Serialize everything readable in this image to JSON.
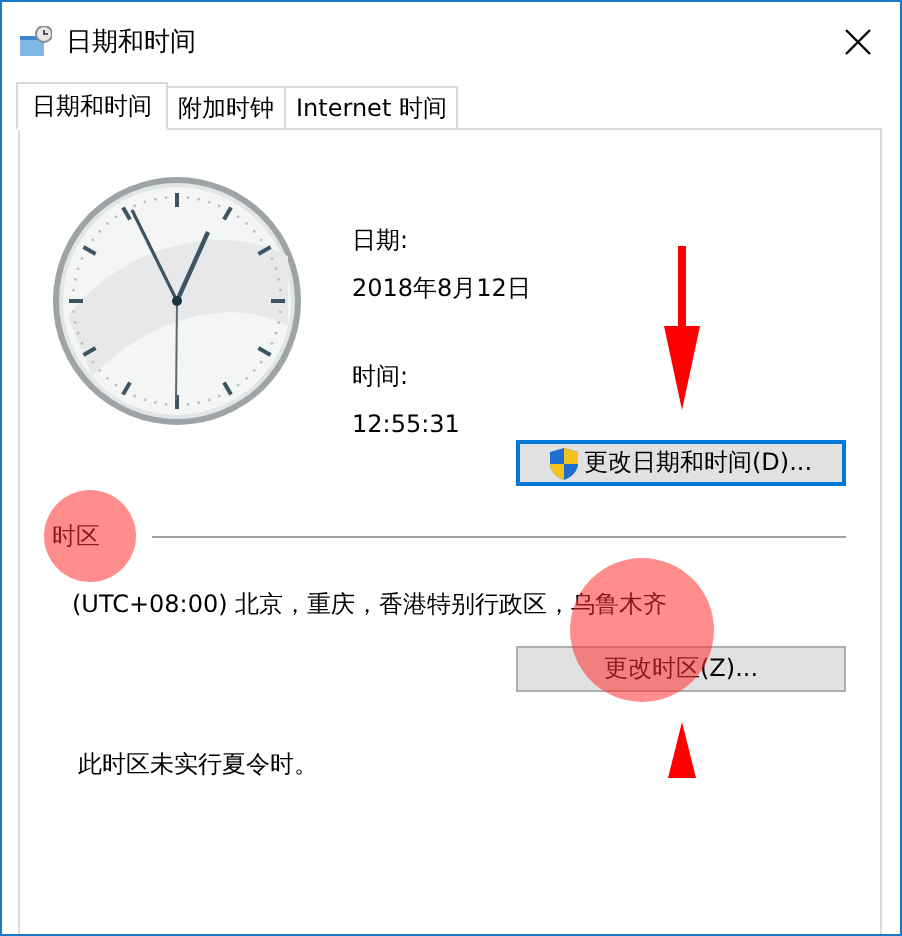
{
  "window": {
    "title": "日期和时间"
  },
  "tabs": [
    {
      "label": "日期和时间",
      "selected": true
    },
    {
      "label": "附加时钟",
      "selected": false
    },
    {
      "label": "Internet 时间",
      "selected": false
    }
  ],
  "date": {
    "label": "日期:",
    "value": "2018年8月12日"
  },
  "time": {
    "label": "时间:",
    "value": "12:55:31"
  },
  "change_datetime_button": {
    "label": "更改日期和时间(D)...",
    "kind": "admin",
    "focused": true
  },
  "timezone": {
    "title": "时区",
    "value": "(UTC+08:00) 北京，重庆，香港特别行政区，乌鲁木齐",
    "button": {
      "label": "更改时区(Z)...",
      "kind": "plain",
      "focused": false
    },
    "note": "此时区未实行夏令时。"
  }
}
